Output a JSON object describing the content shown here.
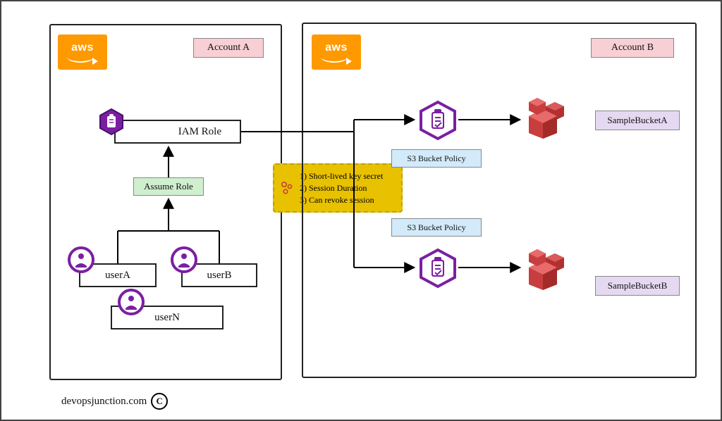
{
  "accountA": {
    "title": "Account A"
  },
  "accountB": {
    "title": "Account B"
  },
  "iamRole": "IAM Role",
  "assumeRole": "Assume Role",
  "users": {
    "a": "userA",
    "b": "userB",
    "n": "userN"
  },
  "note": {
    "line1": "1) Short-lived key secret",
    "line2": "2) Session Duration",
    "line3": "3) Can revoke session"
  },
  "bucketPolicy1": "S3 Bucket Policy",
  "bucketPolicy2": "S3 Bucket Policy",
  "bucketA": "SampleBucketA",
  "bucketB": "SampleBucketB",
  "footer": "devopsjunction.com",
  "colors": {
    "purple": "#7b1fa2",
    "red": "#c83e3e",
    "orange": "#ff9900"
  }
}
